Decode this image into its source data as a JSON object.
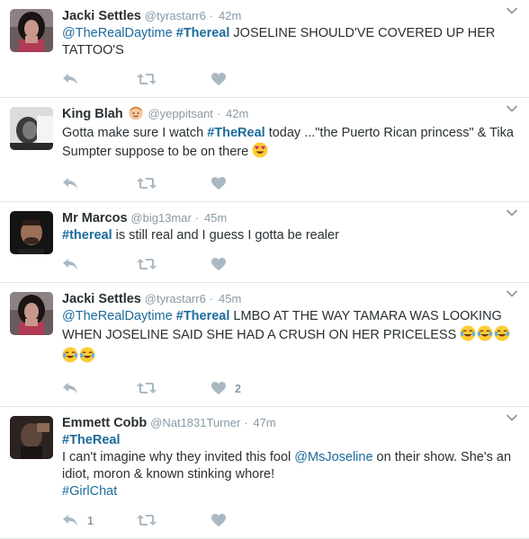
{
  "tweets": [
    {
      "name": "Jacki Settles",
      "handle": "@tyrastarr6",
      "sep": "·",
      "time": "42m",
      "parts": [
        {
          "t": "@TheRealDaytime",
          "c": "link"
        },
        {
          "t": " ",
          "c": ""
        },
        {
          "t": "#Thereal",
          "c": "hashtag"
        },
        {
          "t": " JOSELINE SHOULD'VE COVERED UP HER TATTOO'S",
          "c": ""
        }
      ],
      "reply_count": "",
      "like_count": "",
      "avatar": "woman-dark-hair"
    },
    {
      "name": "King Blah",
      "handle": "@yeppitsant",
      "sep": "·",
      "time": "42m",
      "name_emoji": "man-face-emoji",
      "parts": [
        {
          "t": "Gotta make sure I watch ",
          "c": ""
        },
        {
          "t": "#TheReal",
          "c": "hashtag"
        },
        {
          "t": " today ...\"the Puerto Rican princess\" & Tika Sumpter suppose to be on there ",
          "c": ""
        },
        {
          "t": "",
          "c": "emoji-heart-eyes"
        }
      ],
      "reply_count": "",
      "like_count": "",
      "avatar": "bw-portrait"
    },
    {
      "name": "Mr Marcos",
      "handle": "@big13mar",
      "sep": "·",
      "time": "45m",
      "parts": [
        {
          "t": "#thereal",
          "c": "hashtag"
        },
        {
          "t": " is still real and I guess I gotta be realer",
          "c": ""
        }
      ],
      "reply_count": "",
      "like_count": "",
      "avatar": "man-selfie"
    },
    {
      "name": "Jacki Settles",
      "handle": "@tyrastarr6",
      "sep": "·",
      "time": "45m",
      "parts": [
        {
          "t": "@TheRealDaytime",
          "c": "link"
        },
        {
          "t": " ",
          "c": ""
        },
        {
          "t": "#Thereal",
          "c": "hashtag"
        },
        {
          "t": " LMBO AT THE WAY TAMARA WAS LOOKING WHEN JOSELINE SAID SHE HAD A CRUSH ON HER PRICELESS ",
          "c": ""
        },
        {
          "t": "",
          "c": "emoji-joy"
        },
        {
          "t": "",
          "c": "emoji-joy"
        },
        {
          "t": "",
          "c": "emoji-joy"
        },
        {
          "t": "",
          "c": "emoji-joy"
        },
        {
          "t": "",
          "c": "emoji-joy"
        }
      ],
      "reply_count": "",
      "like_count": "2",
      "avatar": "woman-dark-hair"
    },
    {
      "name": "Emmett Cobb",
      "handle": "@Nat1831Turner",
      "sep": "·",
      "time": "47m",
      "parts": [
        {
          "t": "#TheReal",
          "c": "hashtag"
        },
        {
          "t": "\n",
          "c": "br"
        },
        {
          "t": "I can't imagine why they invited this fool ",
          "c": ""
        },
        {
          "t": "@MsJoseline",
          "c": "link"
        },
        {
          "t": " on their show. She's an idiot, moron & known stinking whore!",
          "c": ""
        },
        {
          "t": "\n",
          "c": "br"
        },
        {
          "t": "#GirlChat",
          "c": "hashtag plain"
        }
      ],
      "reply_count": "1",
      "like_count": "",
      "avatar": "dark-portrait"
    }
  ],
  "icons": {
    "reply": "reply-icon",
    "retweet": "retweet-icon",
    "like": "heart-icon",
    "more": "chevron-down-icon"
  },
  "colors": {
    "link": "#1b6b9c",
    "muted": "#8899a6",
    "icon": "#aab8c2",
    "divider": "#e1e8ed"
  }
}
